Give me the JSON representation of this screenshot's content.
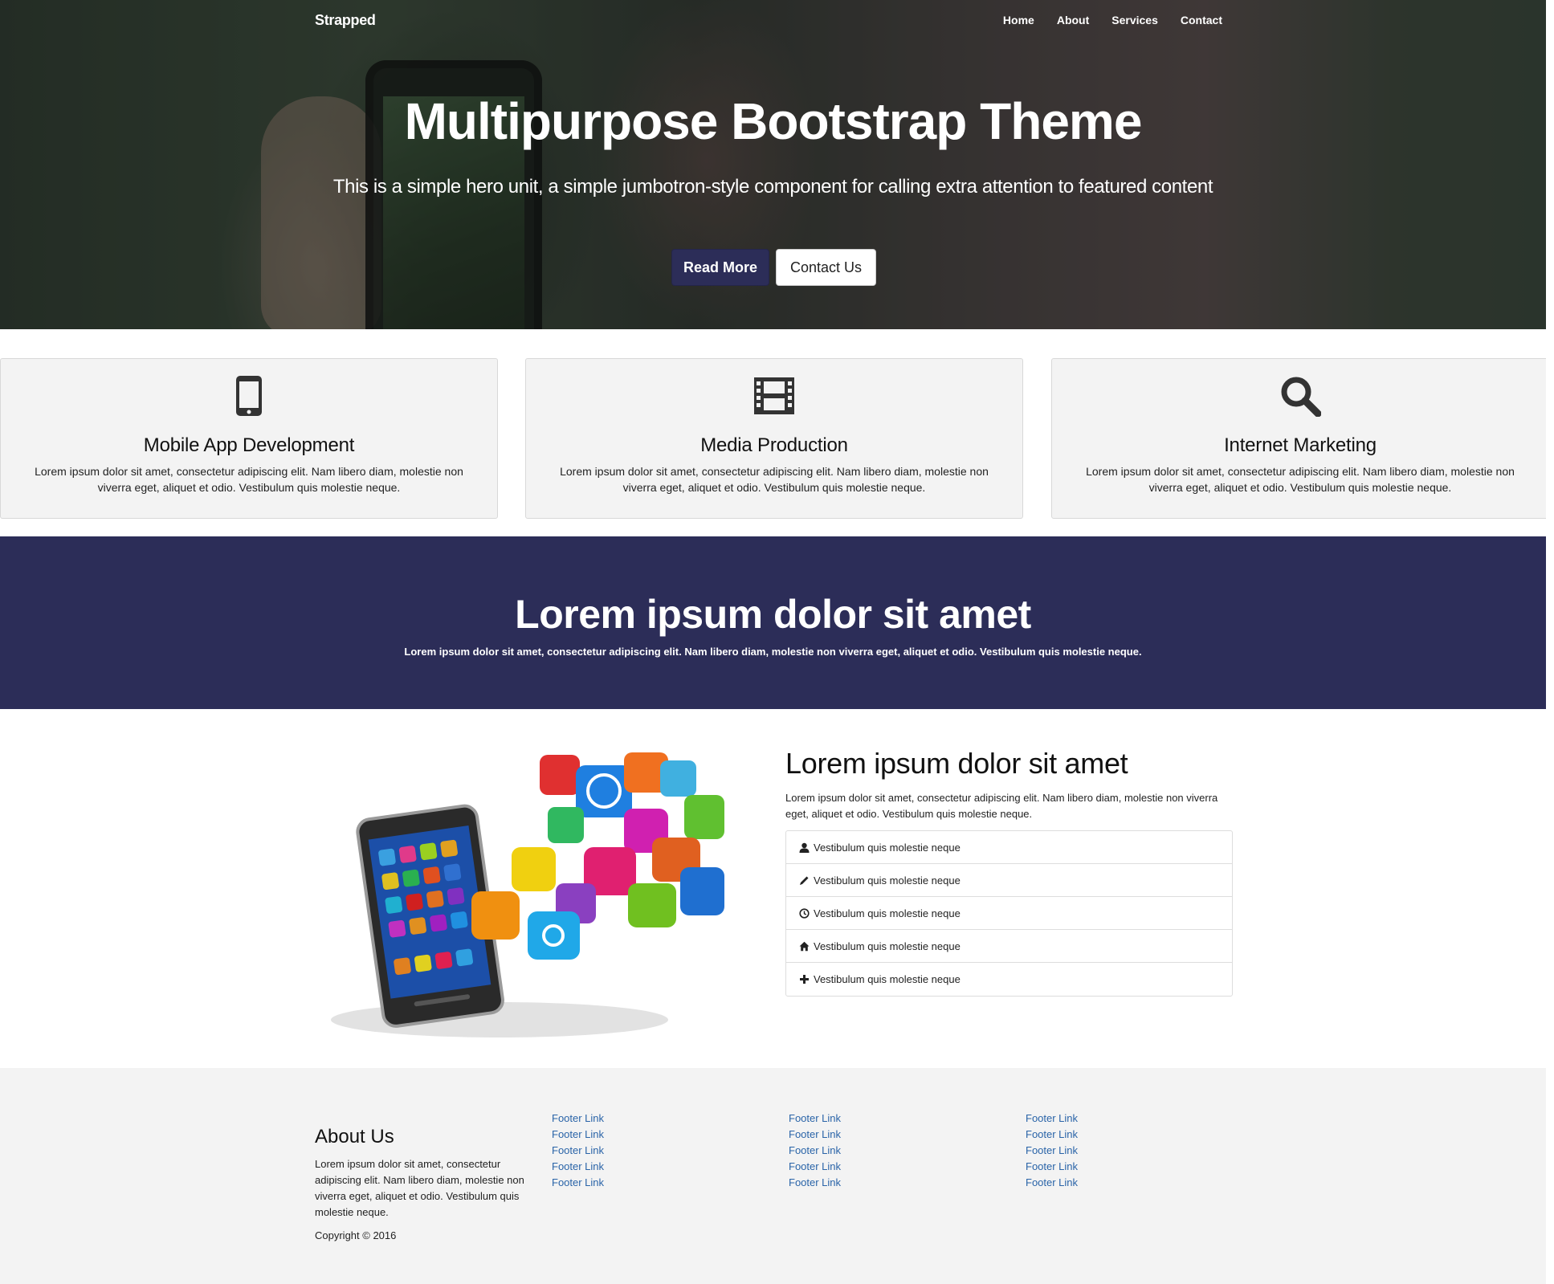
{
  "nav": {
    "brand": "Strapped",
    "links": [
      "Home",
      "About",
      "Services",
      "Contact"
    ]
  },
  "hero": {
    "title": "Multipurpose Bootstrap Theme",
    "subtitle": "This is a simple hero unit, a simple jumbotron-style component for calling extra attention to featured content",
    "primary_button": "Read More",
    "secondary_button": "Contact Us"
  },
  "features": [
    {
      "icon": "mobile-phone-icon",
      "title": "Mobile App Development",
      "text": "Lorem ipsum dolor sit amet, consectetur adipiscing elit. Nam libero diam, molestie non viverra eget, aliquet et odio. Vestibulum quis molestie neque."
    },
    {
      "icon": "film-icon",
      "title": "Media Production",
      "text": "Lorem ipsum dolor sit amet, consectetur adipiscing elit. Nam libero diam, molestie non viverra eget, aliquet et odio. Vestibulum quis molestie neque."
    },
    {
      "icon": "search-icon",
      "title": "Internet Marketing",
      "text": "Lorem ipsum dolor sit amet, consectetur adipiscing elit. Nam libero diam, molestie non viverra eget, aliquet et odio. Vestibulum quis molestie neque."
    }
  ],
  "banner": {
    "title": "Lorem ipsum dolor sit amet",
    "text": "Lorem ipsum dolor sit amet, consectetur adipiscing elit. Nam libero diam, molestie non viverra eget, aliquet et odio. Vestibulum quis molestie neque."
  },
  "content": {
    "title": "Lorem ipsum dolor sit amet",
    "text": "Lorem ipsum dolor sit amet, consectetur adipiscing elit. Nam libero diam, molestie non viverra eget, aliquet et odio. Vestibulum quis molestie neque.",
    "list": [
      {
        "icon": "user-icon",
        "label": "Vestibulum quis molestie neque"
      },
      {
        "icon": "pencil-icon",
        "label": "Vestibulum quis molestie neque"
      },
      {
        "icon": "clock-icon",
        "label": "Vestibulum quis molestie neque"
      },
      {
        "icon": "home-icon",
        "label": "Vestibulum quis molestie neque"
      },
      {
        "icon": "plus-icon",
        "label": "Vestibulum quis molestie neque"
      }
    ]
  },
  "footer": {
    "about_title": "About Us",
    "about_text": "Lorem ipsum dolor sit amet, consectetur adipiscing elit. Nam libero diam, molestie non viverra eget, aliquet et odio. Vestibulum quis molestie neque.",
    "copyright": "Copyright © 2016",
    "columns": [
      [
        "Footer Link",
        "Footer Link",
        "Footer Link",
        "Footer Link",
        "Footer Link"
      ],
      [
        "Footer Link",
        "Footer Link",
        "Footer Link",
        "Footer Link",
        "Footer Link"
      ],
      [
        "Footer Link",
        "Footer Link",
        "Footer Link",
        "Footer Link",
        "Footer Link"
      ]
    ]
  },
  "colors": {
    "primary": "#2c2d58",
    "link": "#2a64a8",
    "panel": "#f3f3f3"
  }
}
